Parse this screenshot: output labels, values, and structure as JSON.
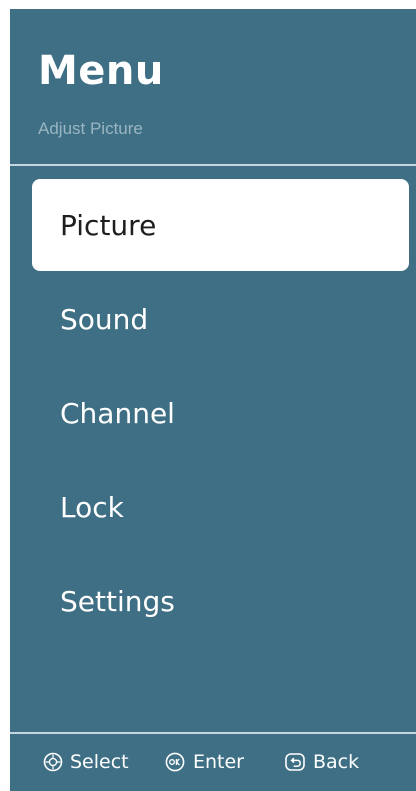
{
  "header": {
    "title": "Menu",
    "subtitle": "Adjust Picture"
  },
  "menu": {
    "selected_index": 0,
    "items": [
      {
        "label": "Picture"
      },
      {
        "label": "Sound"
      },
      {
        "label": "Channel"
      },
      {
        "label": "Lock"
      },
      {
        "label": "Settings"
      }
    ]
  },
  "footer": {
    "hints": [
      {
        "icon": "dpad-icon",
        "label": "Select"
      },
      {
        "icon": "ok-button-icon",
        "label": "Enter"
      },
      {
        "icon": "back-button-icon",
        "label": "Back"
      }
    ]
  },
  "colors": {
    "panel_background": "#3f6f84",
    "selected_background": "#ffffff",
    "text": "#ffffff",
    "selected_text": "#1e1e1e",
    "subtitle": "#9ab6c3"
  }
}
